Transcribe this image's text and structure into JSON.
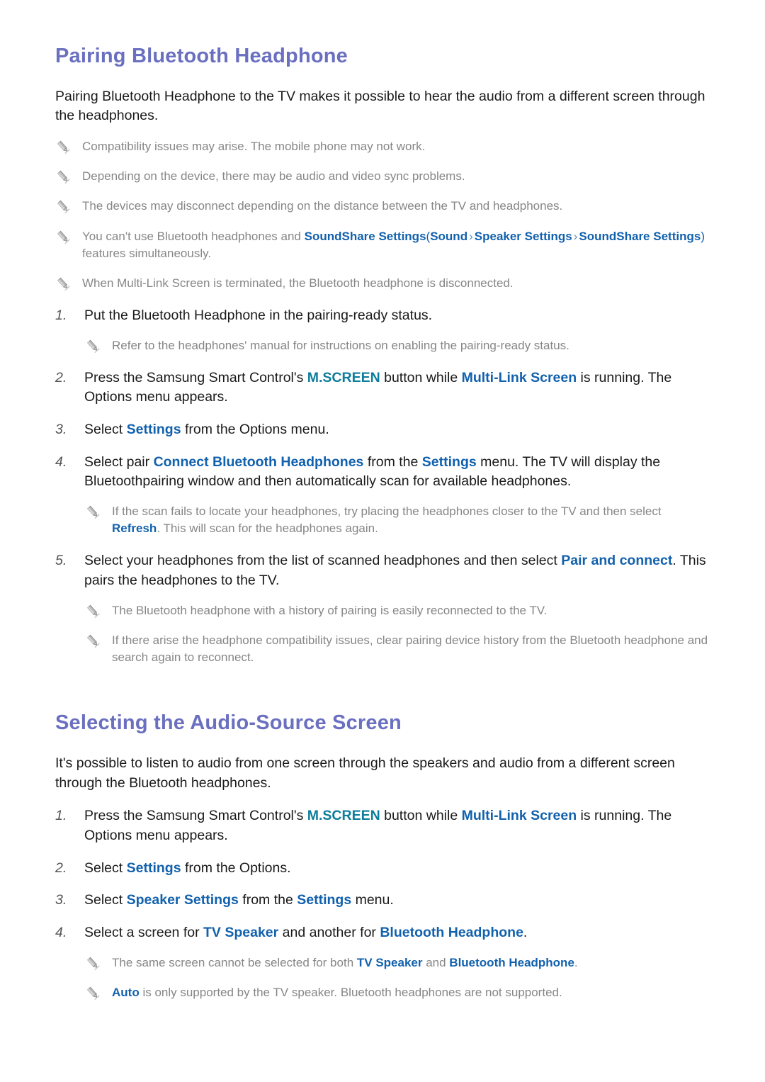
{
  "sections": [
    {
      "heading": "Pairing Bluetooth Headphone",
      "intro": "Pairing Bluetooth Headphone to the TV makes it possible to hear the audio from a different screen through the headphones.",
      "notes_top": [
        "Compatibility issues may arise. The mobile phone may not work.",
        "Depending on the device, there may be audio and video sync problems.",
        "The devices may disconnect depending on the distance between the TV and headphones."
      ],
      "note_soundshare": {
        "lead": "You can't use Bluetooth headphones and ",
        "link1": "SoundShare Settings",
        "open_paren": "(",
        "path1": "Sound",
        "chevron": "›",
        "path2": "Speaker Settings",
        "path3": "SoundShare Settings",
        "close_paren": ")",
        "tail": " features simultaneously."
      },
      "note_multilink": "When Multi-Link Screen is terminated, the Bluetooth headphone is disconnected.",
      "steps": [
        {
          "num": "1.",
          "text": "Put the Bluetooth Headphone in the pairing-ready status.",
          "subnotes": [
            "Refer to the headphones' manual for instructions on enabling the pairing-ready status."
          ]
        },
        {
          "num": "2.",
          "parts": {
            "p1": "Press the Samsung Smart Control's ",
            "k1": "M.SCREEN",
            "p2": " button while ",
            "k2": "Multi-Link Screen",
            "p3": " is running. The Options menu appears."
          }
        },
        {
          "num": "3.",
          "parts": {
            "p1": "Select ",
            "k1": "Settings",
            "p2": " from the Options menu."
          }
        },
        {
          "num": "4.",
          "parts": {
            "p1": "Select pair ",
            "k1": "Connect Bluetooth Headphones",
            "p2": " from the ",
            "k2": "Settings",
            "p3": " menu. The TV will display the Bluetoothpairing window and then automatically scan for available headphones."
          },
          "subnote_parts": {
            "s1": "If the scan fails to locate your headphones, try placing the headphones closer to the TV and then select ",
            "sk1": "Refresh",
            "s2": ". This will scan for the headphones again."
          }
        },
        {
          "num": "5.",
          "parts": {
            "p1": "Select your headphones from the list of scanned headphones and then select ",
            "k1": "Pair and connect",
            "p2": ". This pairs the headphones to the TV."
          },
          "subnotes": [
            "The Bluetooth headphone with a history of pairing is easily reconnected to the TV.",
            "If there arise the headphone compatibility issues, clear pairing device history from the Bluetooth headphone and search again to reconnect."
          ]
        }
      ]
    },
    {
      "heading": "Selecting the Audio-Source Screen",
      "intro": "It's possible to listen to audio from one screen through the speakers and audio from a different screen through the Bluetooth headphones.",
      "steps": [
        {
          "num": "1.",
          "parts": {
            "p1": "Press the Samsung Smart Control's ",
            "k1": "M.SCREEN",
            "p2": " button while ",
            "k2": "Multi-Link Screen",
            "p3": " is running. The Options menu appears."
          }
        },
        {
          "num": "2.",
          "parts": {
            "p1": "Select ",
            "k1": "Settings",
            "p2": " from the Options."
          }
        },
        {
          "num": "3.",
          "parts": {
            "p1": "Select ",
            "k1": "Speaker Settings",
            "p2": " from the ",
            "k2": "Settings",
            "p3": " menu."
          }
        },
        {
          "num": "4.",
          "parts": {
            "p1": "Select a screen for ",
            "k1": "TV Speaker",
            "p2": " and another for ",
            "k2": "Bluetooth Headphone",
            "p3": "."
          },
          "subnote_a": {
            "s1": "The same screen cannot be selected for both ",
            "sk1": "TV Speaker",
            "s2": " and ",
            "sk2": "Bluetooth Headphone",
            "s3": "."
          },
          "subnote_b": {
            "sk1": "Auto",
            "s1": " is only supported by the TV speaker. Bluetooth headphones are not supported."
          }
        }
      ]
    }
  ],
  "icons": {
    "note_bullet": "pencil-icon"
  },
  "colors": {
    "heading": "#6a6fc0",
    "link": "#1261ad",
    "teal": "#0d7d9b",
    "note_text": "#868686",
    "body_text": "#1a1a1a"
  }
}
